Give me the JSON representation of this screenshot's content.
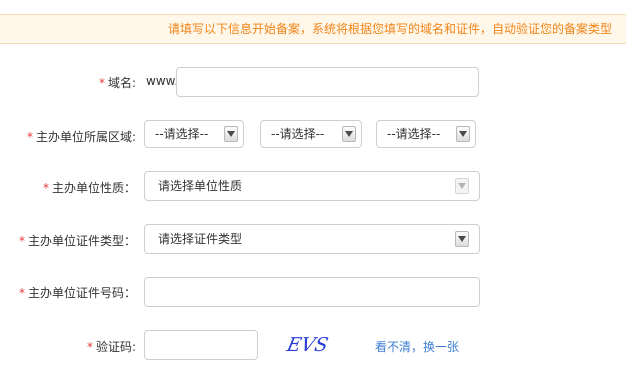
{
  "notice": "请填写以下信息开始备案，系统将根据您填写的域名和证件，自动验证您的备案类型",
  "form": {
    "required_mark": "*",
    "domain": {
      "label": "域名:",
      "prefix": "www.",
      "value": ""
    },
    "region": {
      "label": "主办单位所属区域:",
      "province": "--请选择--",
      "city": "--请选择--",
      "district": "--请选择--"
    },
    "unit_nature": {
      "label": "主办单位性质：",
      "selected": "请选择单位性质"
    },
    "cert_type": {
      "label": "主办单位证件类型：",
      "selected": "请选择证件类型"
    },
    "cert_number": {
      "label": "主办单位证件号码：",
      "value": ""
    },
    "captcha": {
      "label": "验证码:",
      "value": "",
      "image_text": "EVS",
      "refresh_label": "看不清，换一张"
    }
  },
  "colors": {
    "notice_text": "#f08519",
    "notice_bg": "#fff7ea",
    "required": "#e23a3a",
    "link": "#3f7fd4",
    "captcha": "#2b3fd6"
  }
}
